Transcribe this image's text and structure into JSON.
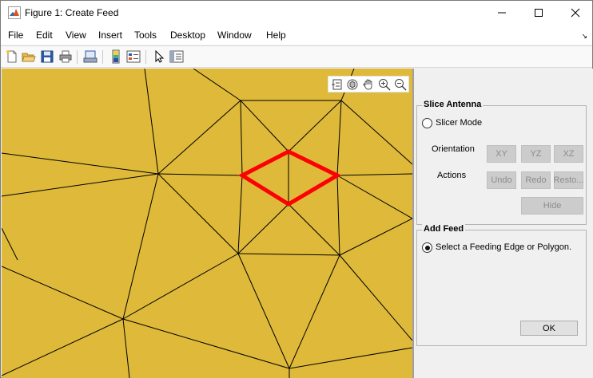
{
  "window": {
    "title": "Figure 1: Create Feed",
    "minimize_icon": "minimize-icon",
    "maximize_icon": "maximize-icon",
    "close_icon": "close-icon"
  },
  "menu": {
    "items": [
      "File",
      "Edit",
      "View",
      "Insert",
      "Tools",
      "Desktop",
      "Window",
      "Help"
    ]
  },
  "toolbar": {
    "icons": [
      "new-figure-icon",
      "open-file-icon",
      "save-icon",
      "print-icon",
      "link-plot-icon",
      "colorbar-icon",
      "legend-icon",
      "edit-plot-icon",
      "property-inspector-icon"
    ]
  },
  "axes_toolbar": {
    "icons": [
      "brush-icon",
      "rotate-3d-icon",
      "pan-icon",
      "zoom-in-icon",
      "zoom-out-icon"
    ]
  },
  "colors": {
    "mesh_fill": "#deb93a",
    "mesh_edge": "#000000",
    "feed_highlight": "#ff0000"
  },
  "slice_antenna": {
    "title": "Slice Antenna",
    "slicer_mode_label": "Slicer Mode",
    "slicer_mode_selected": false,
    "orientation_label": "Orientation",
    "orientation_buttons": [
      "XY",
      "YZ",
      "XZ"
    ],
    "actions_label": "Actions",
    "action_buttons": [
      "Undo",
      "Redo",
      "Resto..."
    ],
    "hide_label": "Hide"
  },
  "add_feed": {
    "title": "Add Feed",
    "option_label": "Select a Feeding Edge or Polygon.",
    "option_selected": true,
    "ok_label": "OK"
  }
}
